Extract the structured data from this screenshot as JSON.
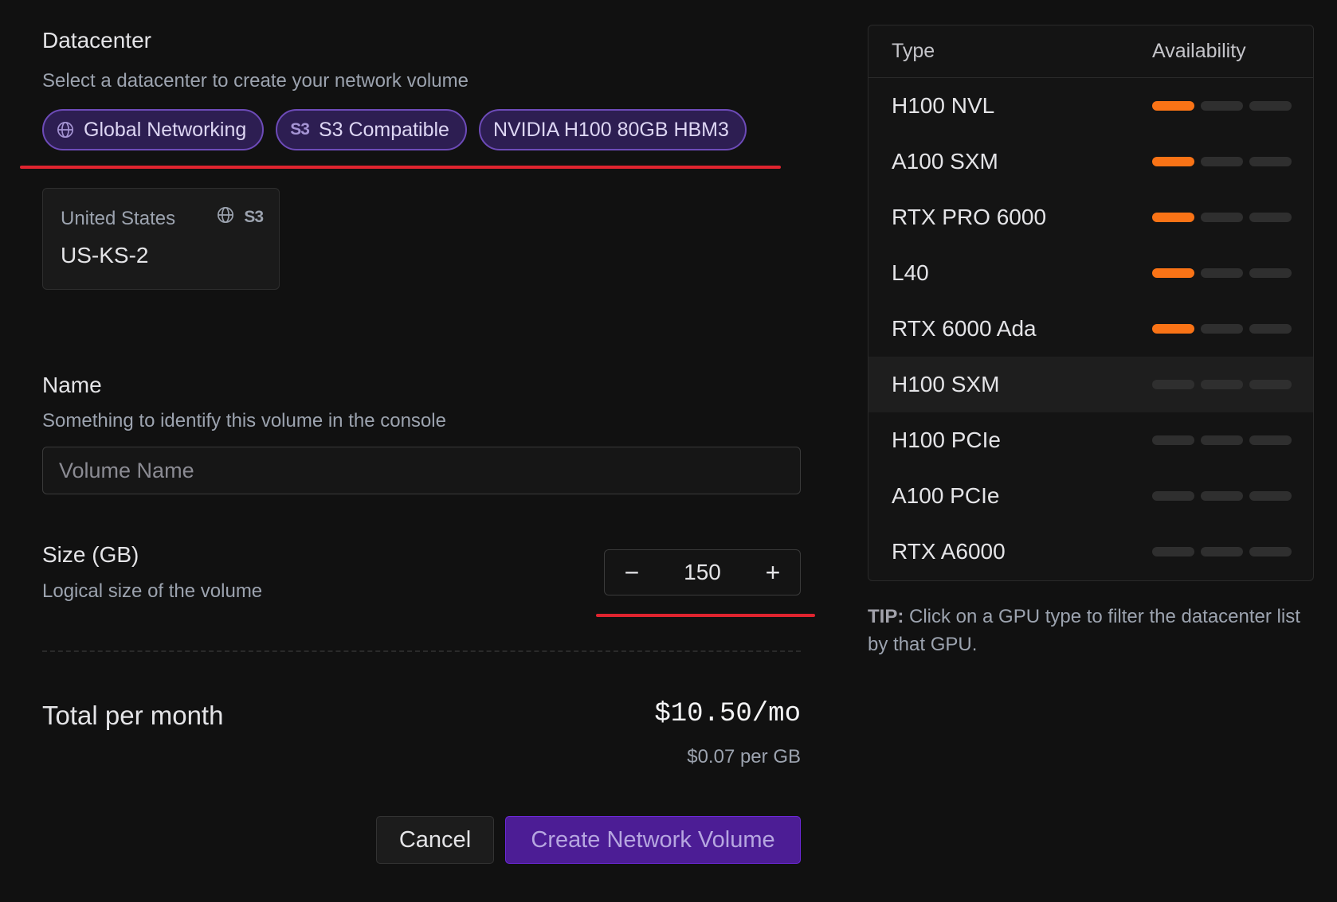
{
  "datacenter": {
    "title": "Datacenter",
    "subtitle": "Select a datacenter to create your network volume",
    "filters": [
      {
        "label": "Global Networking",
        "icon": "globe-icon"
      },
      {
        "label": "S3 Compatible",
        "icon": "s3-icon",
        "icon_text": "S3"
      },
      {
        "label": "NVIDIA H100 80GB HBM3"
      }
    ],
    "card": {
      "region": "United States",
      "code": "US-KS-2",
      "badge_s3": "S3"
    }
  },
  "name": {
    "title": "Name",
    "subtitle": "Something to identify this volume in the console",
    "placeholder": "Volume Name",
    "value": ""
  },
  "size": {
    "title": "Size (GB)",
    "subtitle": "Logical size of the volume",
    "minus": "−",
    "value": "150",
    "plus": "+"
  },
  "total": {
    "label": "Total per month",
    "price": "$10.50/mo",
    "per_gb": "$0.07 per GB"
  },
  "actions": {
    "cancel": "Cancel",
    "create": "Create Network Volume"
  },
  "gpu_table": {
    "headers": {
      "type": "Type",
      "availability": "Availability"
    },
    "rows": [
      {
        "name": "H100 NVL",
        "availability": 1
      },
      {
        "name": "A100 SXM",
        "availability": 1
      },
      {
        "name": "RTX PRO 6000",
        "availability": 1
      },
      {
        "name": "L40",
        "availability": 1
      },
      {
        "name": "RTX 6000 Ada",
        "availability": 1
      },
      {
        "name": "H100 SXM",
        "availability": 0,
        "highlighted": true
      },
      {
        "name": "H100 PCIe",
        "availability": 0
      },
      {
        "name": "A100 PCIe",
        "availability": 0
      },
      {
        "name": "RTX A6000",
        "availability": 0
      }
    ],
    "availability_max": 3
  },
  "tip": {
    "label": "TIP:",
    "text": " Click on a GPU type to filter the datacenter list by that GPU."
  },
  "colors": {
    "accent": "#4c1d95",
    "chip_border": "#6d4bb8",
    "availability_on": "#f97316",
    "availability_off": "#2f2f2f",
    "annotation_red": "#e0242f"
  }
}
